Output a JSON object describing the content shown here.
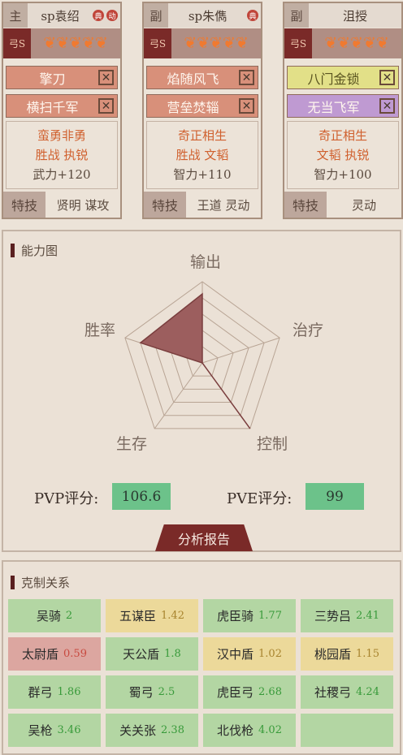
{
  "cards": [
    {
      "role": "主",
      "name": "sp袁绍",
      "badges": [
        "典",
        "动"
      ],
      "troop_label": "弓S",
      "stars": 5,
      "skills": [
        {
          "name": "擎刀",
          "color": "#d8907a",
          "remove": "✕"
        },
        {
          "name": "横扫千军",
          "color": "#d8907a",
          "remove": "✕"
        }
      ],
      "info": {
        "line1": "蛮勇非勇",
        "line2": "胜战 执锐",
        "stat": "武力+120"
      },
      "footer": {
        "tab": "特技",
        "traits": "贤明 谋攻"
      }
    },
    {
      "role": "副",
      "name": "sp朱儁",
      "badges": [
        "典"
      ],
      "troop_label": "弓S",
      "stars": 5,
      "skills": [
        {
          "name": "焰随风飞",
          "color": "#d8907a",
          "remove": "✕"
        },
        {
          "name": "营垒焚辎",
          "color": "#d8907a",
          "remove": "✕"
        }
      ],
      "info": {
        "line1": "奇正相生",
        "line2": "胜战 文韬",
        "stat": "智力+110"
      },
      "footer": {
        "tab": "特技",
        "traits": "王道 灵动"
      }
    },
    {
      "role": "副",
      "name": "沮授",
      "badges": [],
      "troop_label": "弓S",
      "stars": 5,
      "skills": [
        {
          "name": "八门金锁",
          "color": "#e2e088",
          "remove": "✕"
        },
        {
          "name": "无当飞军",
          "color": "#bf9ad2",
          "remove": "✕"
        }
      ],
      "info": {
        "line1": "奇正相生",
        "line2": "文韬 执锐",
        "stat": "智力+100"
      },
      "footer": {
        "tab": "特技",
        "traits": "灵动"
      }
    }
  ],
  "ability": {
    "title": "能力图",
    "axes": [
      "输出",
      "治疗",
      "控制",
      "生存",
      "胜率"
    ],
    "values": [
      0.85,
      0.0,
      1.0,
      0.0,
      0.8
    ],
    "pvp_label": "PVP评分:",
    "pvp_value": "106.6",
    "pve_label": "PVE评分:",
    "pve_value": "99",
    "report_button": "分析报告"
  },
  "counters": {
    "title": "克制关系",
    "items": [
      {
        "name": "吴骑",
        "value": "2",
        "color": "green"
      },
      {
        "name": "五谋臣",
        "value": "1.42",
        "color": "yellow"
      },
      {
        "name": "虎臣骑",
        "value": "1.77",
        "color": "green"
      },
      {
        "name": "三势吕",
        "value": "2.41",
        "color": "green"
      },
      {
        "name": "太尉盾",
        "value": "0.59",
        "color": "red"
      },
      {
        "name": "天公盾",
        "value": "1.8",
        "color": "green"
      },
      {
        "name": "汉中盾",
        "value": "1.02",
        "color": "yellow"
      },
      {
        "name": "桃园盾",
        "value": "1.15",
        "color": "yellow"
      },
      {
        "name": "群弓",
        "value": "1.86",
        "color": "green"
      },
      {
        "name": "蜀弓",
        "value": "2.5",
        "color": "green"
      },
      {
        "name": "虎臣弓",
        "value": "2.68",
        "color": "green"
      },
      {
        "name": "社稷弓",
        "value": "4.24",
        "color": "green"
      },
      {
        "name": "吴枪",
        "value": "3.46",
        "color": "green"
      },
      {
        "name": "关关张",
        "value": "2.38",
        "color": "green"
      },
      {
        "name": "北伐枪",
        "value": "4.02",
        "color": "green"
      },
      {
        "name": "",
        "value": "",
        "color": "green"
      }
    ]
  }
}
